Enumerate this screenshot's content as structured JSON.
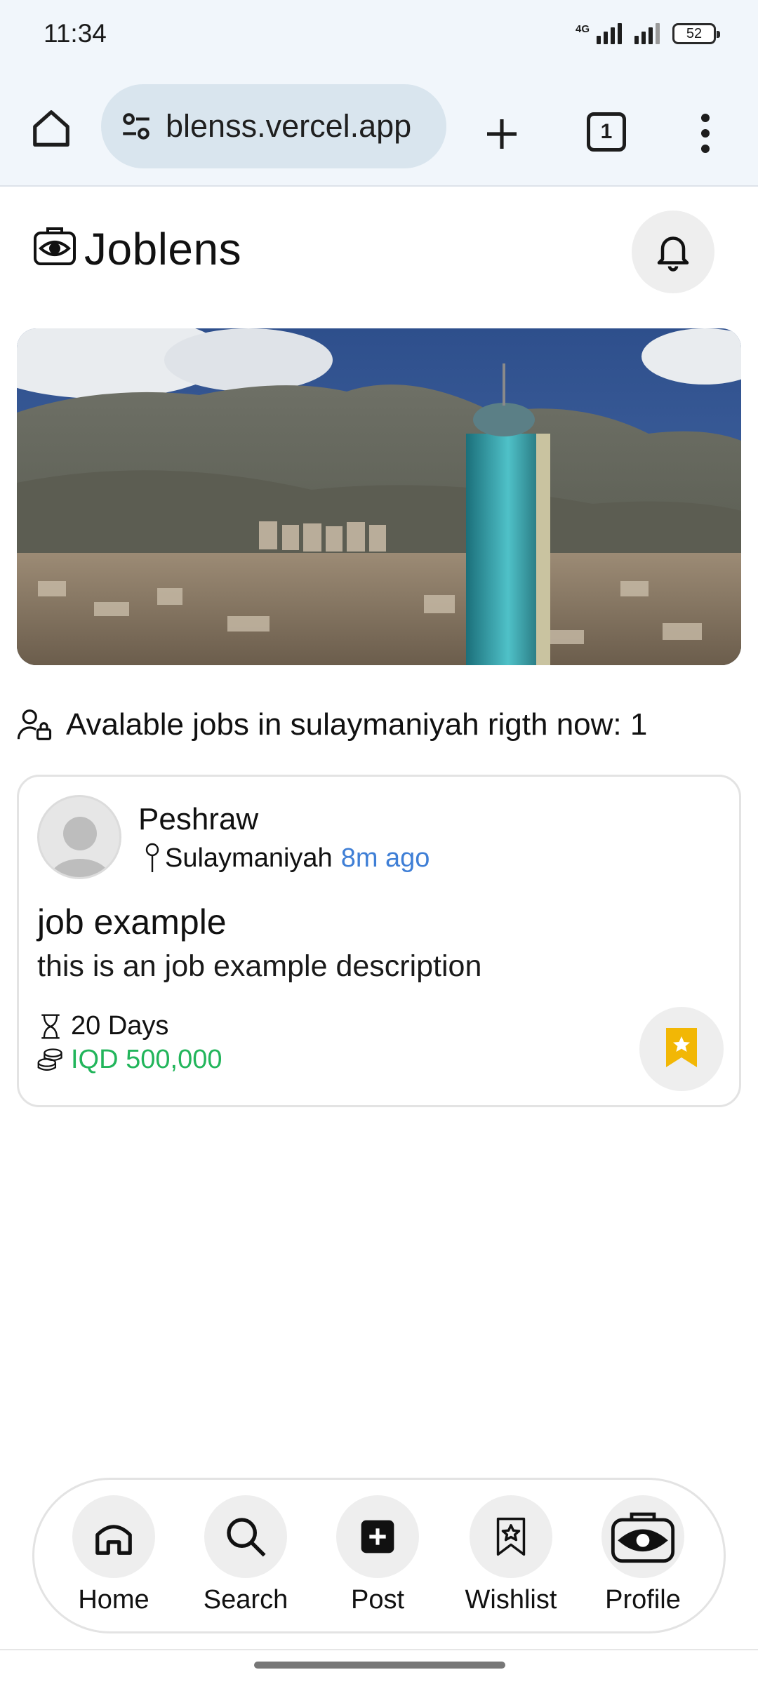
{
  "status_bar": {
    "time": "11:34",
    "network": "4G",
    "battery": "52"
  },
  "browser": {
    "url": "blenss.vercel.app",
    "tab_count": "1",
    "icons": [
      "home-icon",
      "site-settings-icon",
      "new-tab-icon",
      "tabs-icon",
      "more-vert-icon"
    ]
  },
  "header": {
    "title": "Joblens",
    "icons": [
      "joblens-logo-icon",
      "bell-icon"
    ]
  },
  "available": {
    "text": "Avalable jobs in sulaymaniyah rigth now: 1"
  },
  "job": {
    "poster": "Peshraw",
    "location": "Sulaymaniyah",
    "time_ago": "8m ago",
    "title": "job example",
    "description": "this is an job example description",
    "duration": "20 Days",
    "salary": "IQD 500,000"
  },
  "nav": {
    "items": [
      {
        "label": "Home",
        "icon": "home-icon"
      },
      {
        "label": "Search",
        "icon": "search-icon"
      },
      {
        "label": "Post",
        "icon": "add-post-icon"
      },
      {
        "label": "Wishlist",
        "icon": "wishlist-icon"
      },
      {
        "label": "Profile",
        "icon": "profile-eye-icon"
      }
    ]
  },
  "colors": {
    "accent_blue": "#3f7fd6",
    "salary_green": "#22b55b",
    "wishlist_yellow": "#f2b705",
    "browser_bg": "#f1f6fb"
  }
}
